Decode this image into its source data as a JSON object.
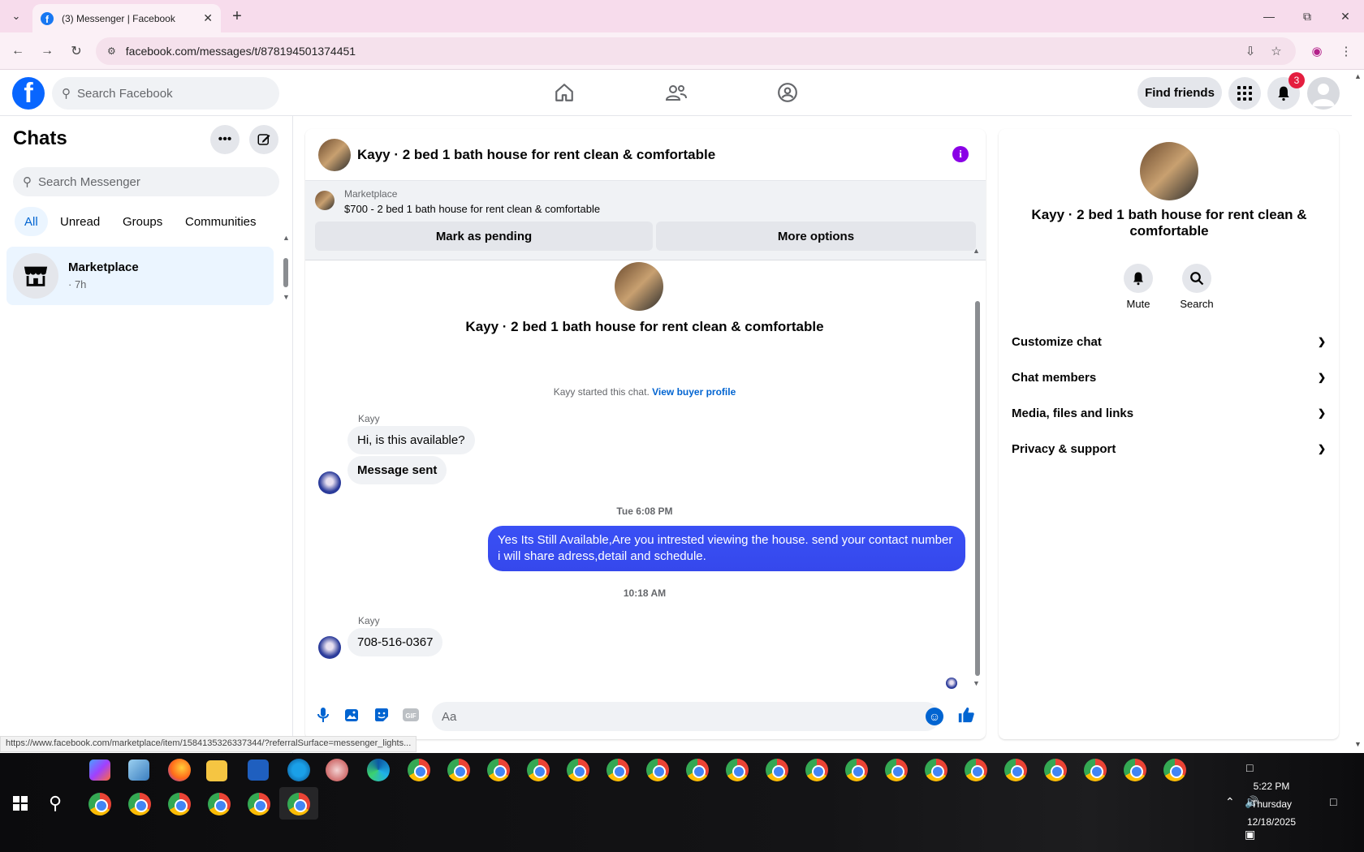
{
  "browser": {
    "tab_title": "(3) Messenger | Facebook",
    "url": "facebook.com/messages/t/878194501374451",
    "status_url": "https://www.facebook.com/marketplace/item/1584135326337344/?referralSurface=messenger_lights..."
  },
  "header": {
    "search_placeholder": "Search Facebook",
    "find_friends_label": "Find friends",
    "notification_count": "3"
  },
  "sidebar": {
    "title": "Chats",
    "search_placeholder": "Search Messenger",
    "filters": [
      "All",
      "Unread",
      "Groups",
      "Communities"
    ],
    "chats": [
      {
        "name": "Marketplace",
        "time": "· 7h"
      }
    ]
  },
  "conversation": {
    "title": "Kayy · 2 bed 1 bath house for rent clean & comfortable",
    "marketplace_label": "Marketplace",
    "listing": "$700 - 2 bed 1 bath house for rent clean & comfortable",
    "mark_pending_label": "Mark as pending",
    "more_options_label": "More options",
    "started_text": "Kayy started this chat.",
    "view_buyer_label": "View buyer profile",
    "messages": [
      {
        "sender": "Kayy",
        "text": "Hi, is this available?"
      },
      {
        "text": "Message sent"
      },
      {
        "timestamp": "Tue 6:08 PM"
      },
      {
        "text": "Yes Its Still Available,Are you intrested viewing the house. send your contact number i will share adress,detail and schedule."
      },
      {
        "timestamp": "10:18 AM"
      },
      {
        "sender": "Kayy",
        "text": "708-516-0367"
      }
    ],
    "composer_placeholder": "Aa"
  },
  "info_panel": {
    "title": "Kayy · 2 bed 1 bath house for rent clean & comfortable",
    "actions": [
      "Mute",
      "Search"
    ],
    "sections": [
      "Customize chat",
      "Chat members",
      "Media, files and links",
      "Privacy & support"
    ]
  },
  "taskbar": {
    "time": "5:22 PM",
    "day": "Thursday",
    "date": "12/18/2025"
  },
  "colors": {
    "accent": "#0064d1",
    "outgoing_bubble": "#3a4ff2",
    "tab_bar": "#f7dcec",
    "badge": "#e41e3f"
  }
}
